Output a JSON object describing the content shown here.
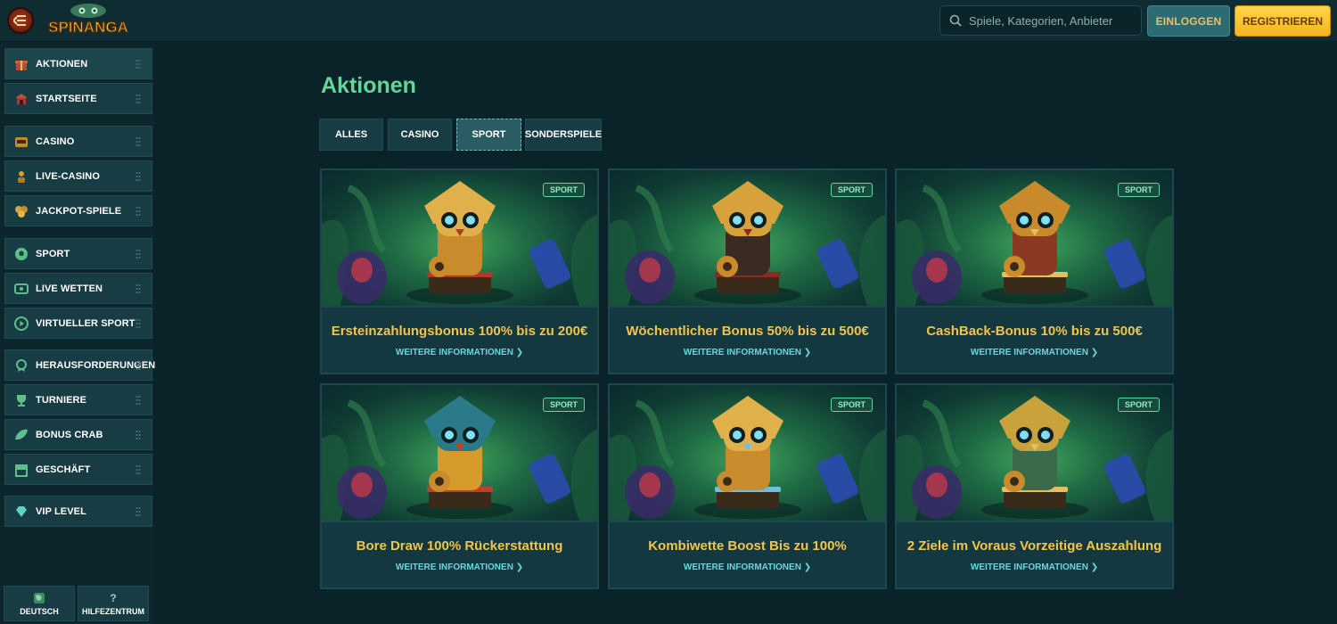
{
  "header": {
    "brand": "SPINANGA",
    "search_placeholder": "Spiele, Kategorien, Anbieter",
    "login_label": "EINLOGGEN",
    "register_label": "REGISTRIEREN"
  },
  "sidebar": {
    "items": [
      {
        "label": "AKTIONEN",
        "icon": "gift-icon"
      },
      {
        "label": "STARTSEITE",
        "icon": "temple-icon"
      },
      {
        "label": "CASINO",
        "icon": "slot-machine-icon"
      },
      {
        "label": "LIVE-CASINO",
        "icon": "dealer-icon"
      },
      {
        "label": "JACKPOT-SPIELE",
        "icon": "coins-icon"
      },
      {
        "label": "SPORT",
        "icon": "soccer-ball-icon"
      },
      {
        "label": "LIVE WETTEN",
        "icon": "live-tv-icon"
      },
      {
        "label": "VIRTUELLER SPORT",
        "icon": "play-icon"
      },
      {
        "label": "HERAUSFORDERUNGEN",
        "icon": "medal-icon"
      },
      {
        "label": "TURNIERE",
        "icon": "trophy-icon"
      },
      {
        "label": "BONUS CRAB",
        "icon": "leaf-icon"
      },
      {
        "label": "GESCHÄFT",
        "icon": "shop-icon"
      },
      {
        "label": "VIP LEVEL",
        "icon": "diamond-icon"
      }
    ],
    "bottom": {
      "language_label": "DEUTSCH",
      "help_label": "HILFEZENTRUM"
    }
  },
  "main": {
    "title": "Aktionen",
    "tabs": [
      {
        "label": "ALLES"
      },
      {
        "label": "CASINO"
      },
      {
        "label": "SPORT"
      },
      {
        "label": "SONDERSPIELE"
      }
    ],
    "active_tab": "SPORT",
    "more_label": "WEITERE INFORMATIONEN ❯",
    "cards": [
      {
        "badge": "SPORT",
        "title": "Ersteinzahlungsbonus 100% bis zu 200€"
      },
      {
        "badge": "SPORT",
        "title": "Wöchentlicher Bonus 50% bis zu 500€"
      },
      {
        "badge": "SPORT",
        "title": "CashBack-Bonus 10% bis zu 500€"
      },
      {
        "badge": "SPORT",
        "title": "Bore Draw 100% Rückerstattung"
      },
      {
        "badge": "SPORT",
        "title": "Kombiwette Boost Bis zu 100%"
      },
      {
        "badge": "SPORT",
        "title": "2 Ziele im Voraus Vorzeitige Auszahlung"
      }
    ]
  },
  "colors": {
    "background": "#0a2329",
    "accent_green": "#63d69a",
    "title_gold": "#f2c44c",
    "register_yellow": "#ffd54a",
    "link_cyan": "#6fd3d9"
  }
}
